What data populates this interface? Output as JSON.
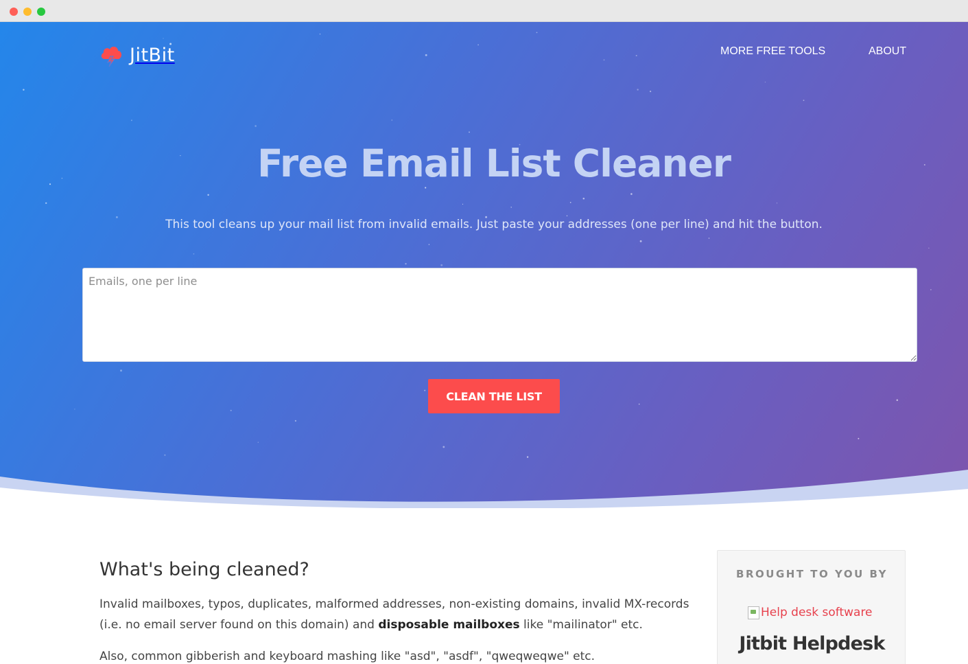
{
  "browser": {
    "window_controls": [
      "close",
      "minimize",
      "zoom"
    ]
  },
  "header": {
    "logo_text": "JitBit",
    "logo_icon": "cloud-lightning-icon",
    "nav": {
      "more_tools": "MORE FREE TOOLS",
      "about": "ABOUT"
    }
  },
  "hero": {
    "title": "Free Email List Cleaner",
    "subtitle": "This tool cleans up your mail list from invalid emails. Just paste your addresses (one per line) and hit the button.",
    "email_input": {
      "placeholder": "Emails, one per line",
      "value": ""
    },
    "clean_button_label": "CLEAN THE LIST"
  },
  "content": {
    "section_title": "What's being cleaned?",
    "para1_prefix": "Invalid mailboxes, typos, duplicates, malformed addresses, non-existing domains, invalid MX-records (i.e. no email server found on this domain) and ",
    "para1_bold": "disposable mailboxes",
    "para1_suffix": " like \"mailinator\" etc.",
    "para2": "Also, common gibberish and keyboard mashing like \"asd\", \"asdf\", \"qweqweqwe\" etc."
  },
  "sponsor": {
    "label": "BROUGHT TO YOU BY",
    "image_alt": "Help desk software",
    "name": "Jitbit Helpdesk"
  },
  "colors": {
    "hero_gradient_start": "#2486ea",
    "hero_gradient_end": "#7d55ad",
    "accent_button": "#fc4c4c",
    "link_red": "#e7414d"
  }
}
